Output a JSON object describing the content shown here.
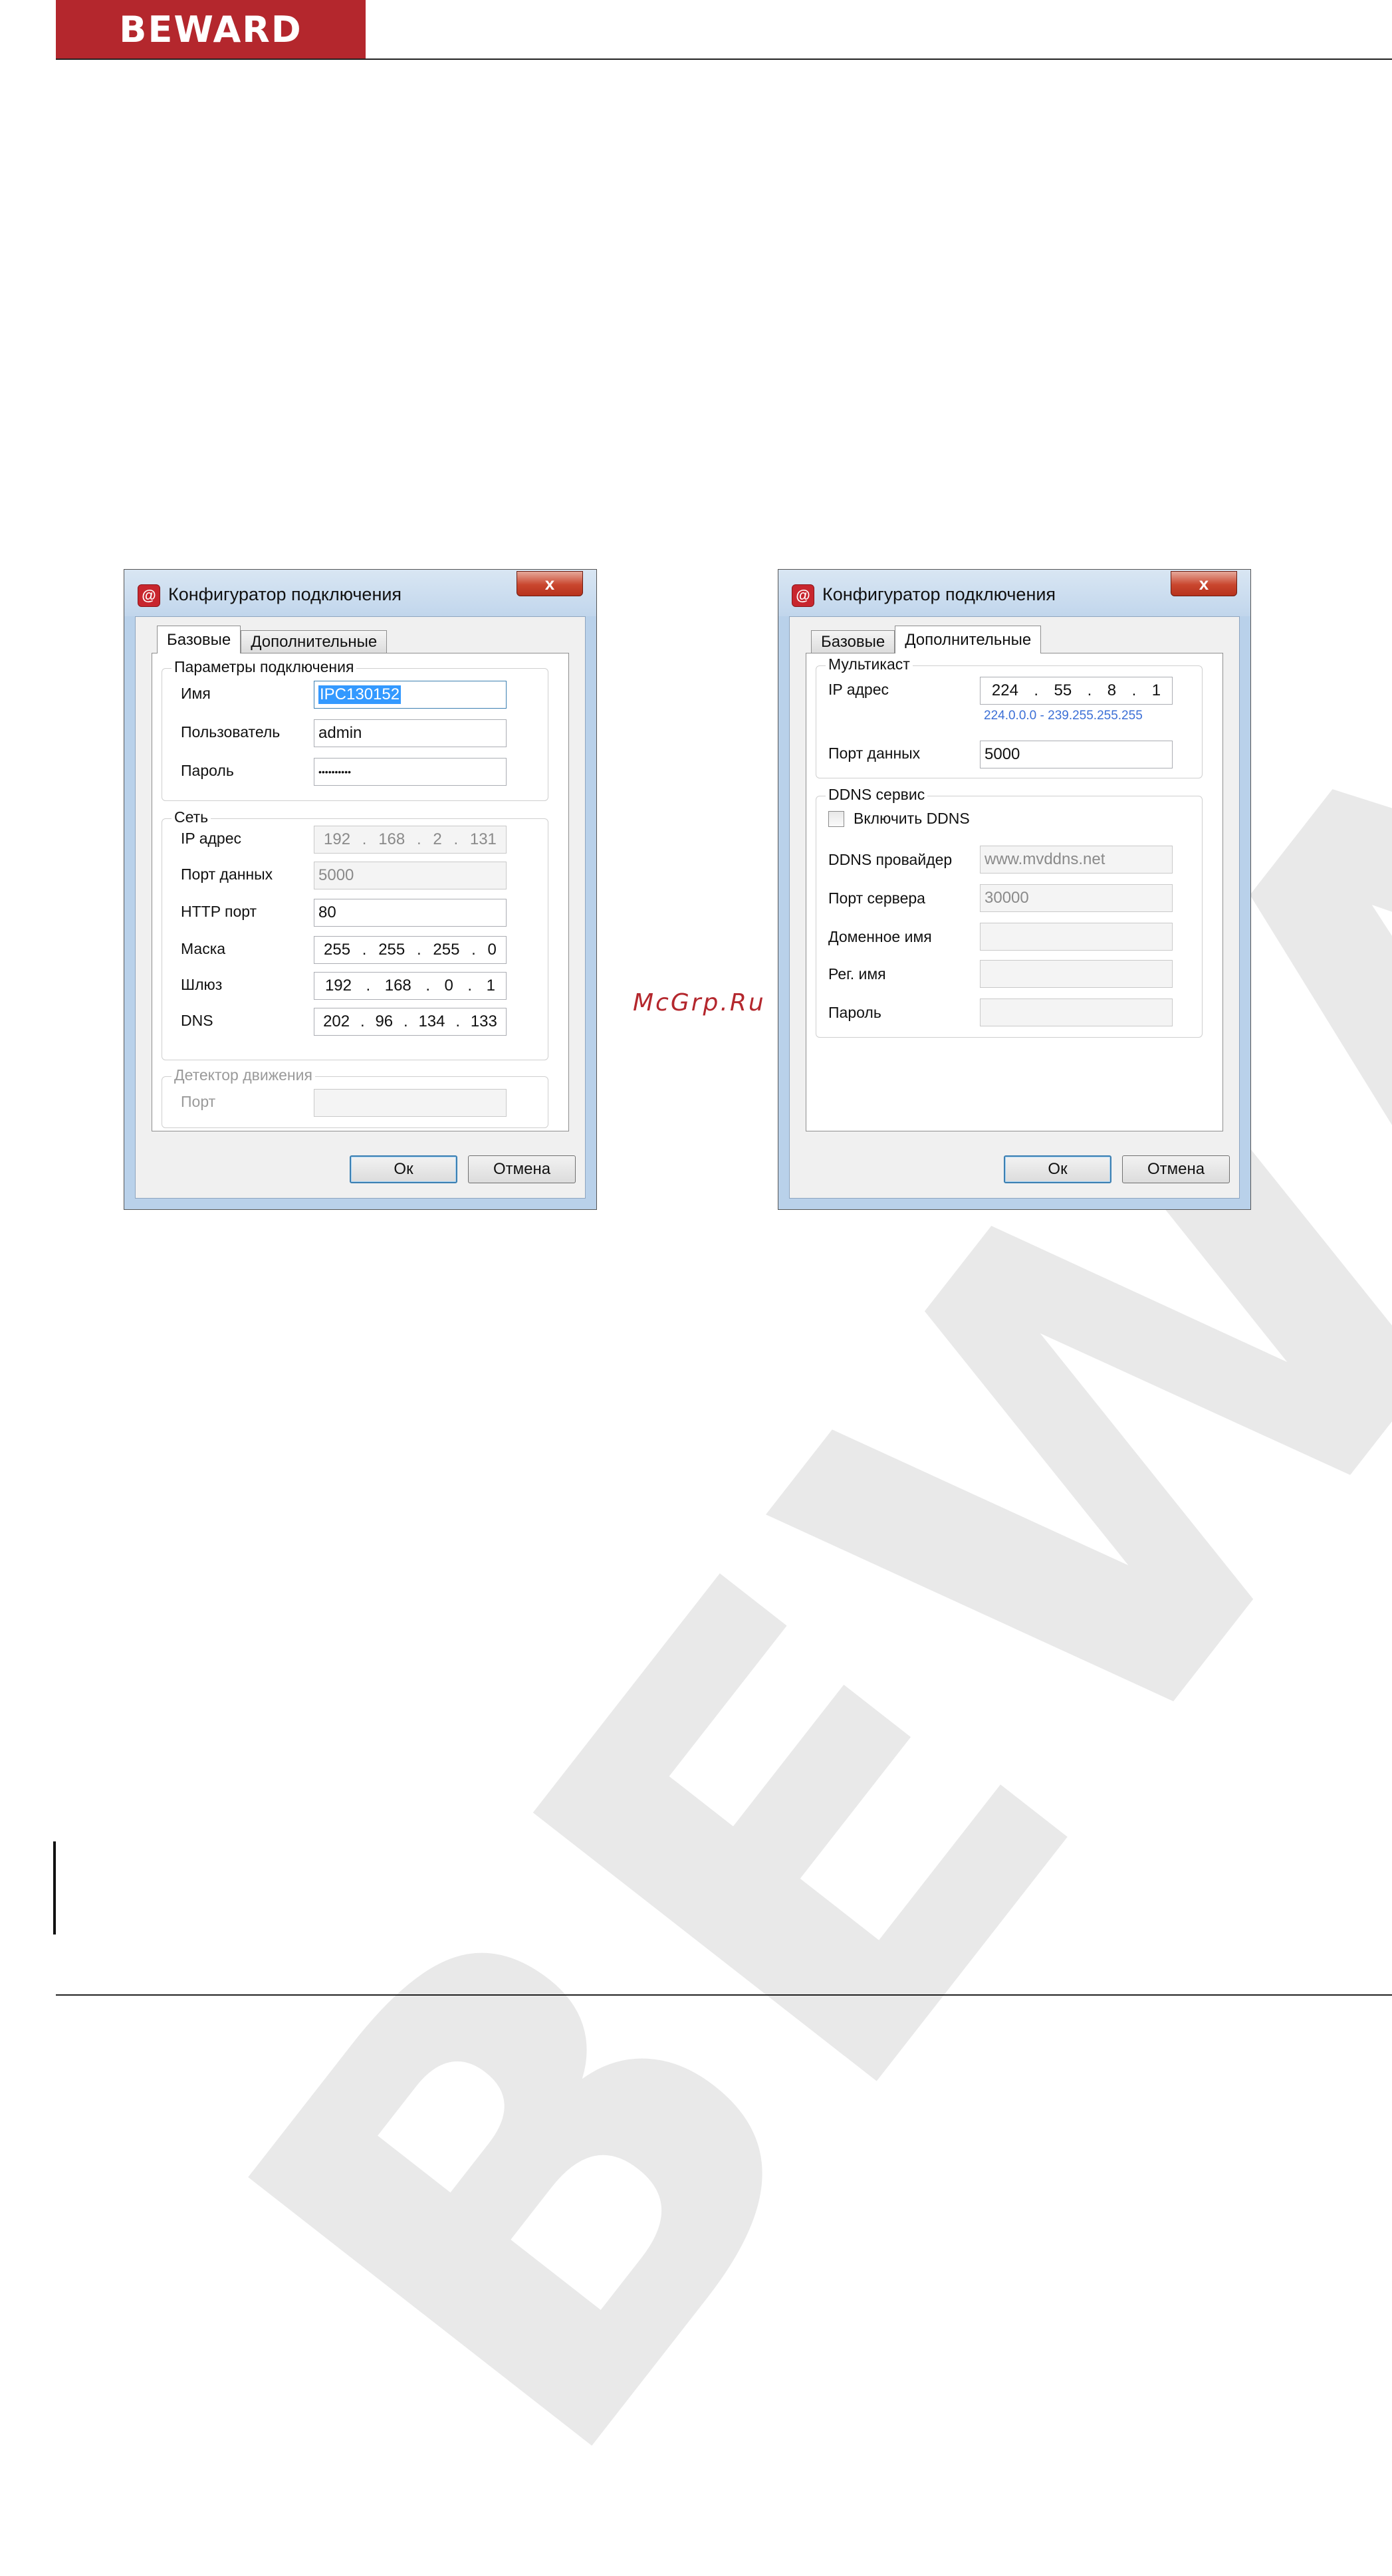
{
  "header": {
    "logo_text": "BEWARD"
  },
  "watermark": {
    "text": "BEWARD",
    "color": "#e9e9e9"
  },
  "site_tag": "McGrp.Ru",
  "colors": {
    "brand_red": "#b4272d",
    "selection_blue": "#3399ff",
    "hint_blue": "#3b6fd6"
  },
  "dialog_left": {
    "title": "Конфигуратор подключения",
    "close_label": "x",
    "tabs": [
      {
        "label": "Базовые",
        "active": true
      },
      {
        "label": "Дополнительные",
        "active": false
      }
    ],
    "connection_group": {
      "legend": "Параметры подключения",
      "name_label": "Имя",
      "name_value": "IPC130152",
      "user_label": "Пользователь",
      "user_value": "admin",
      "password_label": "Пароль",
      "password_value": "••••••••••"
    },
    "network_group": {
      "legend": "Сеть",
      "ip_label": "IP адрес",
      "ip": [
        "192",
        "168",
        "2",
        "131"
      ],
      "data_port_label": "Порт данных",
      "data_port_value": "5000",
      "http_port_label": "HTTP порт",
      "http_port_value": "80",
      "mask_label": "Маска",
      "mask": [
        "255",
        "255",
        "255",
        "0"
      ],
      "gateway_label": "Шлюз",
      "gateway": [
        "192",
        "168",
        "0",
        "1"
      ],
      "dns_label": "DNS",
      "dns": [
        "202",
        "96",
        "134",
        "133"
      ]
    },
    "motion_group": {
      "legend": "Детектор движения",
      "port_label": "Порт",
      "port_value": ""
    },
    "ok_label": "Ок",
    "cancel_label": "Отмена"
  },
  "dialog_right": {
    "title": "Конфигуратор подключения",
    "close_label": "x",
    "tabs": [
      {
        "label": "Базовые",
        "active": false
      },
      {
        "label": "Дополнительные",
        "active": true
      }
    ],
    "multicast_group": {
      "legend": "Мультикаст",
      "ip_label": "IP адрес",
      "ip": [
        "224",
        "55",
        "8",
        "1"
      ],
      "ip_hint": "224.0.0.0 - 239.255.255.255",
      "data_port_label": "Порт данных",
      "data_port_value": "5000"
    },
    "ddns_group": {
      "legend": "DDNS сервис",
      "enable_label": "Включить DDNS",
      "enable_checked": false,
      "provider_label": "DDNS провайдер",
      "provider_value": "www.mvddns.net",
      "server_port_label": "Порт сервера",
      "server_port_value": "30000",
      "domain_label": "Доменное имя",
      "domain_value": "",
      "reg_name_label": "Рег. имя",
      "reg_name_value": "",
      "password_label": "Пароль",
      "password_value": ""
    },
    "ok_label": "Ок",
    "cancel_label": "Отмена"
  }
}
